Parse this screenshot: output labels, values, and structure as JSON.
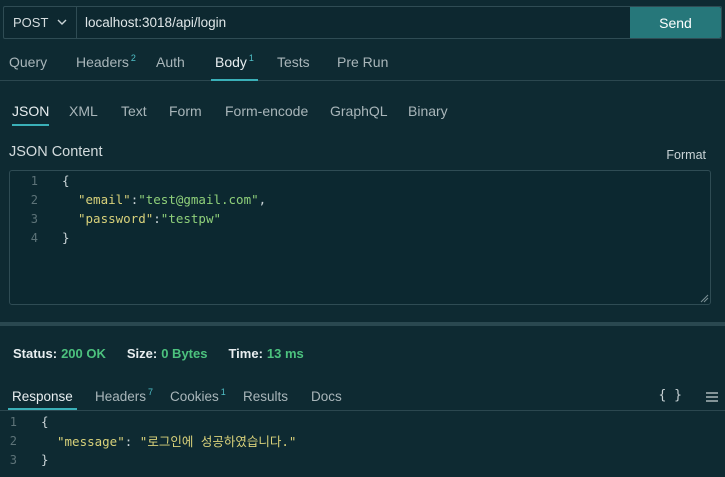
{
  "request": {
    "method": "POST",
    "url": "localhost:3018/api/login",
    "send_label": "Send"
  },
  "request_tabs": [
    {
      "label": "Query",
      "badge": ""
    },
    {
      "label": "Headers",
      "badge": "2"
    },
    {
      "label": "Auth",
      "badge": ""
    },
    {
      "label": "Body",
      "badge": "1"
    },
    {
      "label": "Tests",
      "badge": ""
    },
    {
      "label": "Pre Run",
      "badge": ""
    }
  ],
  "body_tabs": [
    "JSON",
    "XML",
    "Text",
    "Form",
    "Form-encode",
    "GraphQL",
    "Binary"
  ],
  "json_content": {
    "label": "JSON Content",
    "format_label": "Format",
    "lines": [
      {
        "num": "1",
        "text": "{"
      },
      {
        "num": "2",
        "key": "\"email\"",
        "value": "\"test@gmail.com\"",
        "trail": ","
      },
      {
        "num": "3",
        "key": "\"password\"",
        "value": "\"testpw\"",
        "trail": ""
      },
      {
        "num": "4",
        "text": "}"
      }
    ]
  },
  "status_bar": {
    "status_label": "Status:",
    "status_value": "200 OK",
    "size_label": "Size:",
    "size_value": "0 Bytes",
    "time_label": "Time:",
    "time_value": "13 ms"
  },
  "response_tabs": [
    {
      "label": "Response",
      "badge": ""
    },
    {
      "label": "Headers",
      "badge": "7"
    },
    {
      "label": "Cookies",
      "badge": "1"
    },
    {
      "label": "Results",
      "badge": ""
    },
    {
      "label": "Docs",
      "badge": ""
    }
  ],
  "response_icons": {
    "braces": "{ }",
    "menu": "menu-icon"
  },
  "response_body": [
    {
      "num": "1",
      "text": "{"
    },
    {
      "num": "2",
      "key": "\"message\"",
      "value": "\"로그인에 성공하였습니다.\""
    },
    {
      "num": "3",
      "text": "}"
    }
  ],
  "colors": {
    "background": "#0e2a32",
    "accent": "#26777a",
    "tab_underline": "#3ab0b8",
    "status_ok": "#4cc27e"
  }
}
